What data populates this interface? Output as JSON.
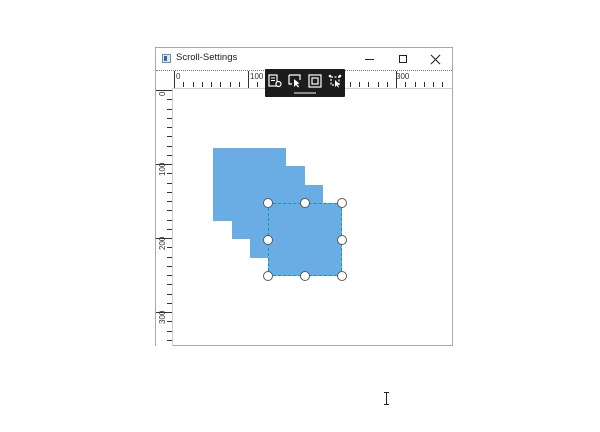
{
  "window": {
    "title": "Scroll-Settings",
    "app_icon": "app-window-icon",
    "controls": [
      "minimize-icon",
      "maximize-icon",
      "close-icon"
    ]
  },
  "rulers": {
    "horizontal_labels": [
      "0",
      "100",
      "300"
    ],
    "vertical_labels": [
      "0",
      "100",
      "200",
      "300"
    ]
  },
  "diagram": {
    "shape_fill": "#6aade4",
    "selection_border": "#0a9f9f",
    "handle_count": 8
  },
  "quick_toolbar": {
    "icons": [
      "edit-properties-icon",
      "select-pointer-icon",
      "fit-to-page-icon",
      "move-select-icon"
    ]
  },
  "colors": {
    "toolbar_bg": "#1c1c1c",
    "window_border": "#a9a9a9"
  }
}
